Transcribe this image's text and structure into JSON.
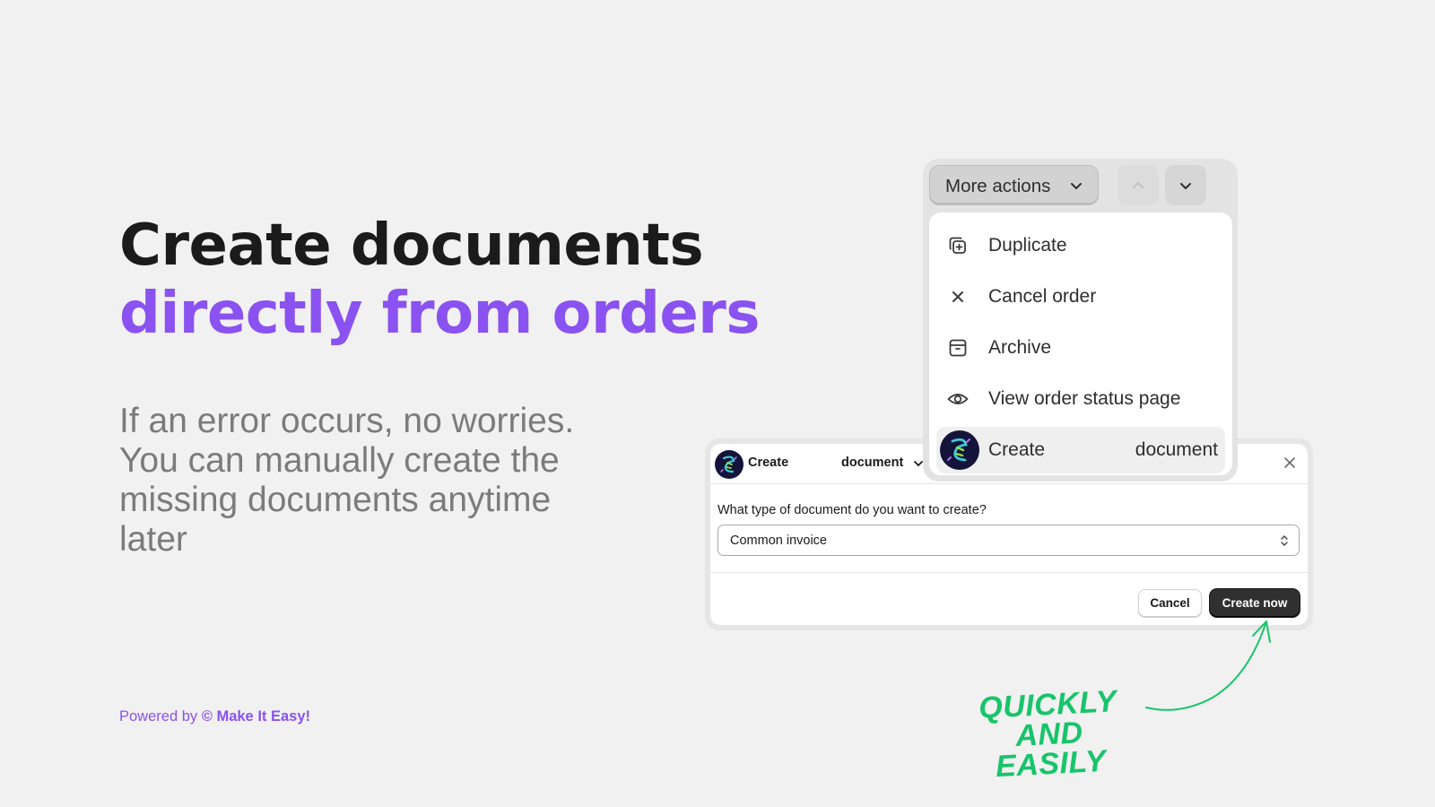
{
  "headline": {
    "line1": "Create documents",
    "line2": "directly from orders"
  },
  "subtext": "If an error occurs, no worries. You can manually create the missing documents anytime later",
  "footer": {
    "prefix": "Powered by ",
    "brand": "© Make It Easy!"
  },
  "modal": {
    "title_left": "Create",
    "title_right": "document",
    "question": "What type of document do you want to create?",
    "select_value": "Common invoice",
    "cancel_label": "Cancel",
    "create_label": "Create now"
  },
  "toolbar": {
    "more_actions_label": "More actions"
  },
  "menu": {
    "items": [
      {
        "label": "Duplicate",
        "icon": "duplicate-icon"
      },
      {
        "label": "Cancel order",
        "icon": "close-icon"
      },
      {
        "label": "Archive",
        "icon": "archive-icon"
      },
      {
        "label": "View order status page",
        "icon": "eye-icon"
      },
      {
        "label": "Create",
        "label_right": "document",
        "icon": "app-logo-icon"
      }
    ]
  },
  "annotation": {
    "line1": "QUICKLY",
    "line2": "AND EASILY"
  },
  "colors": {
    "accent": "#8a52f0",
    "annotation": "#18c46a",
    "primary_button": "#303030",
    "background": "#f1f1f1"
  }
}
